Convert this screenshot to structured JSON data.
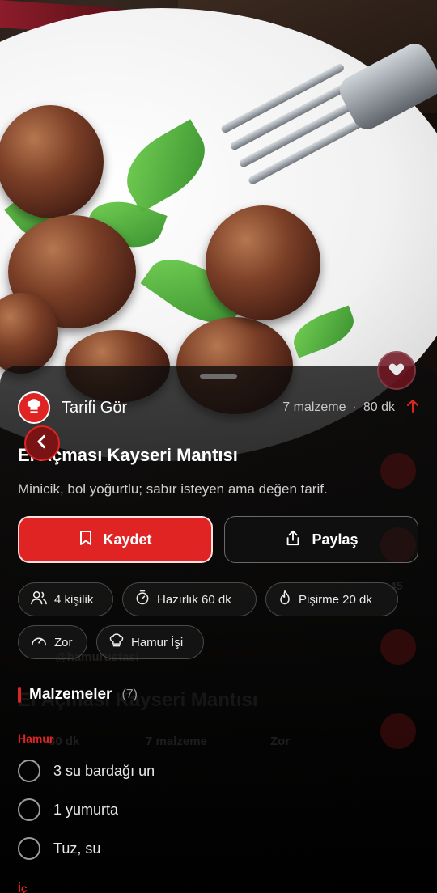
{
  "header": {
    "brand_label": "Tarifi Gör",
    "ingredient_count": "7 malzeme",
    "separator": "·",
    "duration": "80 dk"
  },
  "recipe": {
    "title": "El Açması Kayseri Mantısı",
    "subtitle": "Minicik, bol yoğurtlu; sabır isteyen ama değen tarif."
  },
  "actions": {
    "save_label": "Kaydet",
    "share_label": "Paylaş"
  },
  "chips": [
    {
      "label": "4 kişilik",
      "icon": "people-icon"
    },
    {
      "label": "Hazırlık 60 dk",
      "icon": "timer-icon"
    },
    {
      "label": "Pişirme 20 dk",
      "icon": "flame-icon"
    },
    {
      "label": "Zor",
      "icon": "gauge-icon"
    },
    {
      "label": "Hamur İşi",
      "icon": "chef-hat-icon"
    }
  ],
  "ingredients": {
    "section_title": "Malzemeler",
    "count": "(7)",
    "groups": [
      {
        "label": "Hamur",
        "items": [
          "3 su bardağı un",
          "1 yumurta",
          "Tuz, su"
        ]
      },
      {
        "label": "İç",
        "items": []
      }
    ]
  },
  "ghost": {
    "username": "@hamurustasi",
    "title": "El Açması Kayseri Mantısı",
    "duration": "80 dk",
    "ingredients": "7 malzeme",
    "difficulty": "Zor",
    "count": "45"
  },
  "colors": {
    "accent": "#e02424",
    "sheet": "#0a0a0a",
    "text_secondary": "#cfcfcf"
  }
}
